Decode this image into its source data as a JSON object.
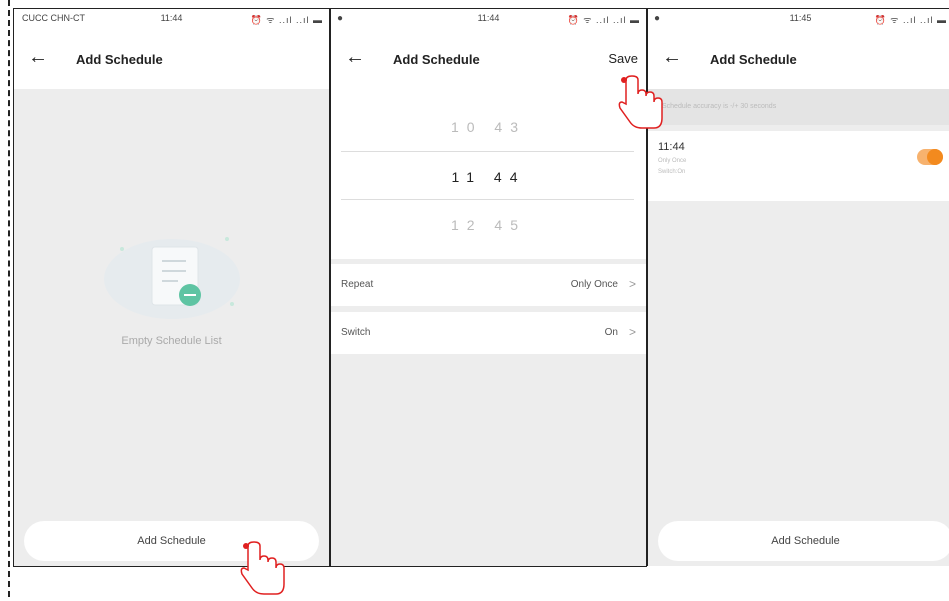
{
  "panel1": {
    "status": {
      "carrier": "CUCC CHN-CT",
      "time": "11:44",
      "icons": "⏰ ᯤ ..ıl ..ıl ▬"
    },
    "header": {
      "title": "Add Schedule"
    },
    "empty_text": "Empty Schedule List",
    "add_button": "Add Schedule"
  },
  "panel2": {
    "status": {
      "indicator": "●",
      "time": "11:44",
      "icons": "⏰ ᯤ ..ıl ..ıl ▬"
    },
    "header": {
      "title": "Add Schedule",
      "save": "Save"
    },
    "picker": {
      "above": "10  43",
      "selected": "11  44",
      "below": "12  45"
    },
    "repeat": {
      "label": "Repeat",
      "value": "Only Once"
    },
    "switch": {
      "label": "Switch",
      "value": "On"
    }
  },
  "panel3": {
    "status": {
      "indicator": "●",
      "time": "11:45",
      "icons": "⏰ ᯤ ..ıl ..ıl ▬"
    },
    "header": {
      "title": "Add Schedule"
    },
    "notice": "Schedule accuracy is -/+ 30 seconds",
    "schedule": {
      "time": "11:44",
      "repeat": "Only Once",
      "switch": "Switch:On",
      "enabled": true
    },
    "add_button": "Add Schedule"
  },
  "colors": {
    "accent": "#f38a1e",
    "tap_marker": "#e02020"
  },
  "icons": {
    "back": "arrow-left-icon",
    "chevron": "chevron-right-icon",
    "tap": "hand-pointer-icon"
  }
}
